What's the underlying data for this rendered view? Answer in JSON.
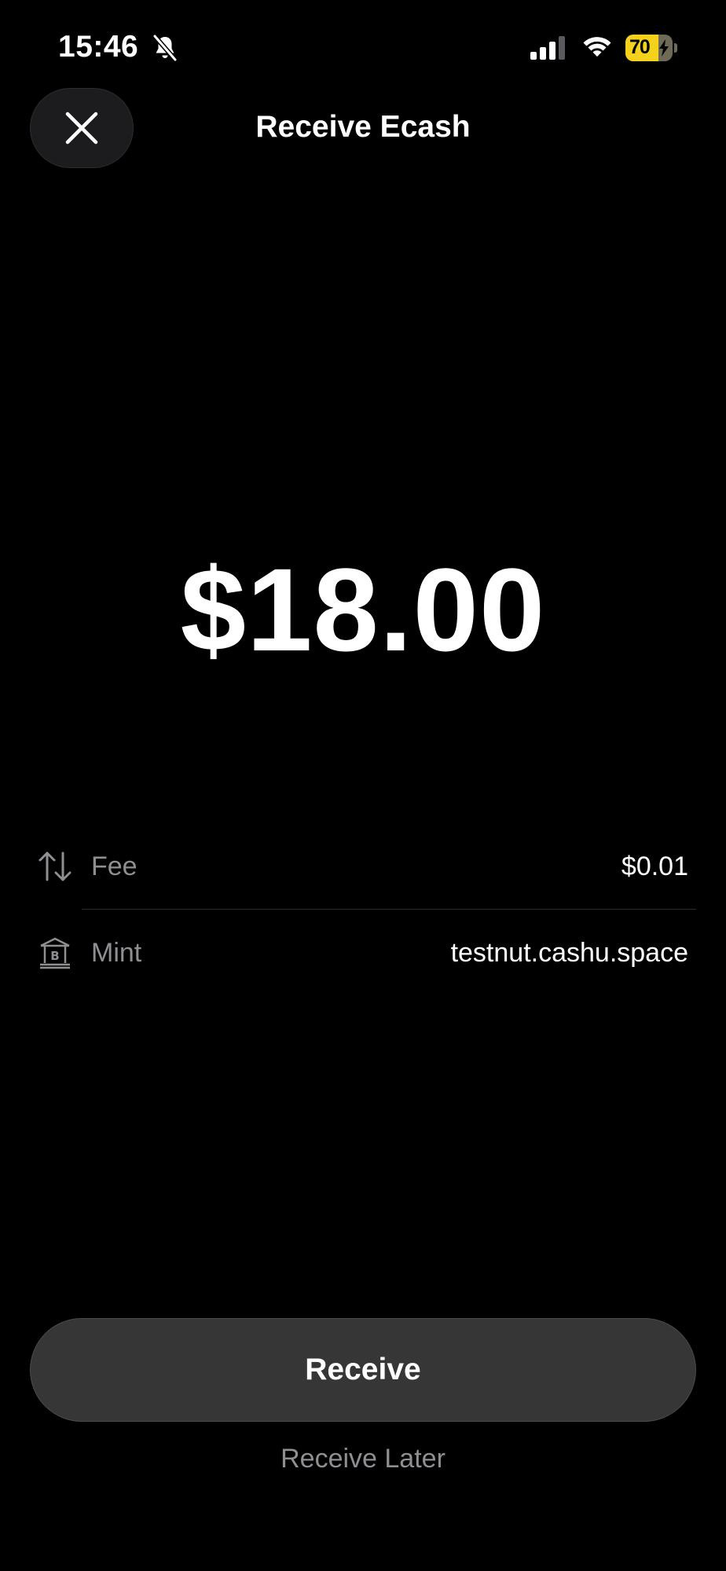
{
  "status_bar": {
    "time": "15:46",
    "battery_percent": "70",
    "battery_level": 0.7,
    "icons": [
      "bell-slash-icon",
      "cellular-signal-icon",
      "wifi-icon",
      "battery-charging-icon"
    ]
  },
  "header": {
    "title": "Receive Ecash",
    "close_icon": "close-icon"
  },
  "amount": {
    "display": "$18.00"
  },
  "details": [
    {
      "label": "Fee",
      "value": "$0.01",
      "icon": "arrows-up-down-icon"
    },
    {
      "label": "Mint",
      "value": "testnut.cashu.space",
      "icon": "bank-bitcoin-icon"
    }
  ],
  "actions": {
    "primary_label": "Receive",
    "secondary_label": "Receive Later"
  },
  "colors": {
    "background": "#000000",
    "button_bg": "#363636",
    "muted_text": "#8e8e93",
    "battery_accent": "#f4d21c"
  }
}
